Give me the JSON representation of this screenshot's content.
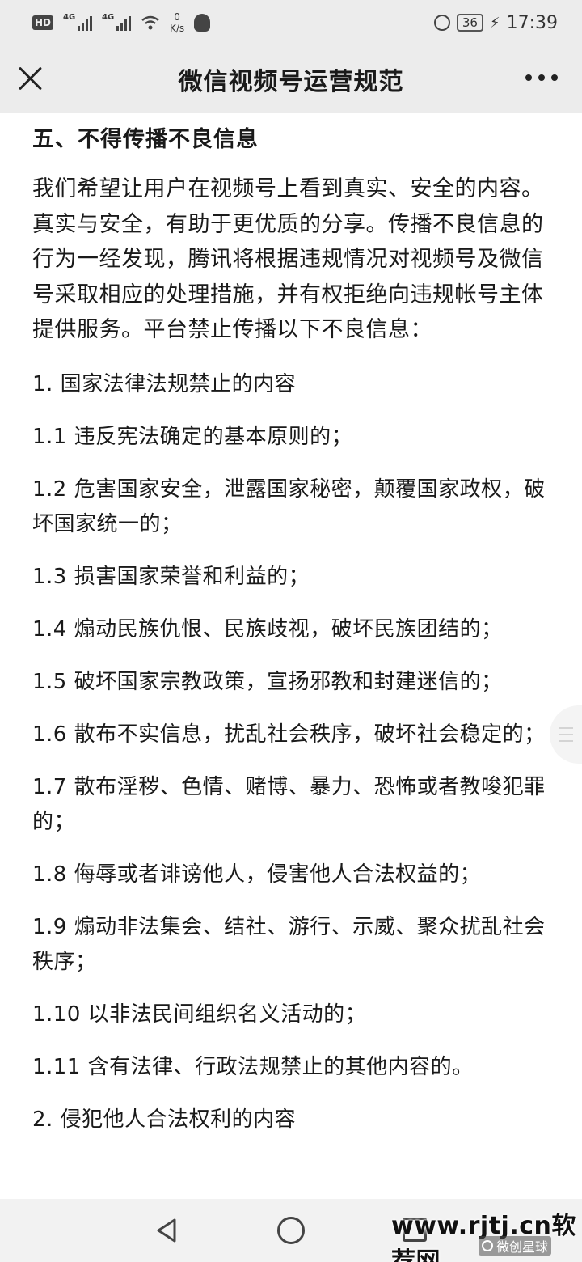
{
  "status_bar": {
    "hd_badge": "HD",
    "sim1_label": "4G",
    "sim2_label": "4G",
    "speed_value": "0",
    "speed_unit": "K/s",
    "battery": "36",
    "time": "17:39"
  },
  "titlebar": {
    "title": "微信视频号运营规范"
  },
  "article": {
    "heading": "五、不得传播不良信息",
    "intro": "我们希望让用户在视频号上看到真实、安全的内容。真实与安全，有助于更优质的分享。传播不良信息的行为一经发现，腾讯将根据违规情况对视频号及微信号采取相应的处理措施，并有权拒绝向违规帐号主体提供服务。平台禁止传播以下不良信息：",
    "items": [
      "1. 国家法律法规禁止的内容",
      "1.1 违反宪法确定的基本原则的；",
      "1.2 危害国家安全，泄露国家秘密，颠覆国家政权，破坏国家统一的；",
      "1.3 损害国家荣誉和利益的；",
      "1.4 煽动民族仇恨、民族歧视，破坏民族团结的；",
      "1.5 破坏国家宗教政策，宣扬邪教和封建迷信的；",
      "1.6 散布不实信息，扰乱社会秩序，破坏社会稳定的；",
      "1.7 散布淫秽、色情、赌博、暴力、恐怖或者教唆犯罪的；",
      "1.8 侮辱或者诽谤他人，侵害他人合法权益的；",
      "1.9 煽动非法集会、结社、游行、示威、聚众扰乱社会秩序；",
      "1.10 以非法民间组织名义活动的；",
      "1.11 含有法律、行政法规禁止的其他内容的。",
      "2. 侵犯他人合法权利的内容"
    ]
  },
  "watermark": {
    "site": "www.rjtj.cn软荐网",
    "sub": "微创星球"
  }
}
